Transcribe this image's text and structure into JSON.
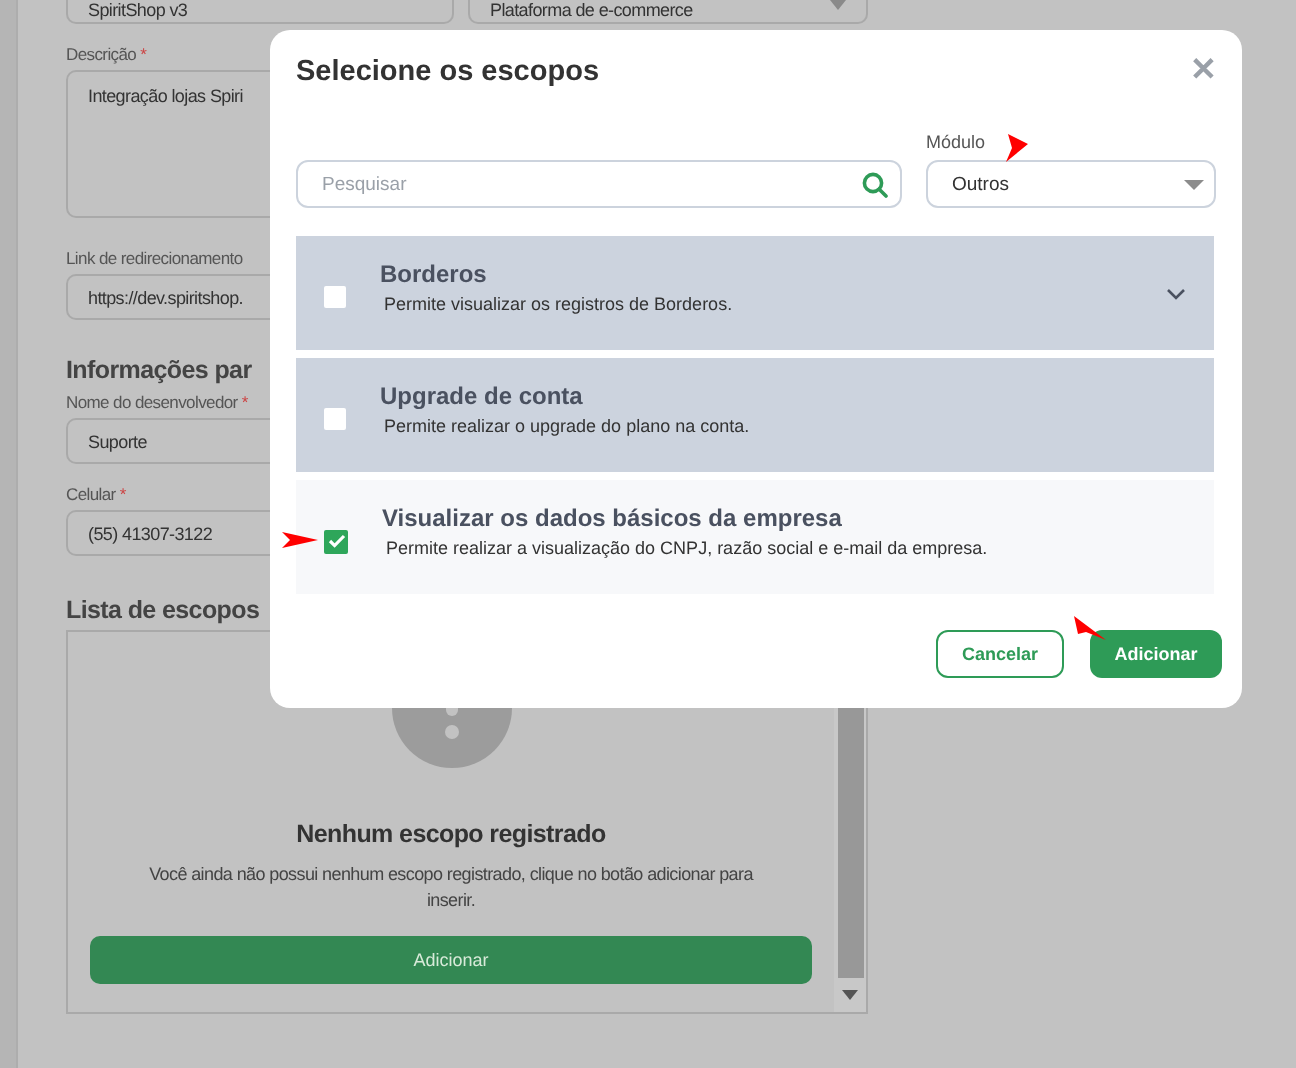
{
  "form": {
    "top_fields": [
      {
        "value": "SpiritShop v3",
        "kind": "text"
      },
      {
        "value": "Plataforma de e-commerce",
        "kind": "select"
      }
    ],
    "description": {
      "label": "Descrição",
      "required_mark": "*",
      "value": "Integração lojas Spiri"
    },
    "redirect": {
      "label": "Link de redirecionamento",
      "value": "https://dev.spiritshop."
    },
    "section_title": "Informações par",
    "developer": {
      "label": "Nome do desenvolvedor",
      "required_mark": "*",
      "value": "Suporte"
    },
    "phone": {
      "label": "Celular",
      "required_mark": "*",
      "value": "(55) 41307-3122"
    },
    "scopes_title": "Lista de escopos",
    "empty_state": {
      "title": "Nenhum escopo registrado",
      "text": "Você ainda não possui nenhum escopo registrado, clique no botão adicionar para inserir.",
      "button": "Adicionar"
    }
  },
  "dialog": {
    "title": "Selecione os escopos",
    "close": "✕",
    "search": {
      "placeholder": "Pesquisar"
    },
    "module": {
      "label": "Módulo",
      "value": "Outros"
    },
    "scopes": [
      {
        "title": "Borderos",
        "description": "Permite visualizar os registros de Borderos.",
        "checked": false,
        "expandable": true
      },
      {
        "title": "Upgrade de conta",
        "description": "Permite realizar o upgrade do plano na conta.",
        "checked": false,
        "expandable": false
      },
      {
        "title": "Visualizar os dados básicos da empresa",
        "description": "Permite realizar a visualização do CNPJ, razão social e e-mail da empresa.",
        "checked": true,
        "expandable": false
      }
    ],
    "buttons": [
      {
        "label": "Cancelar",
        "kind": "secondary"
      },
      {
        "label": "Adicionar",
        "kind": "primary"
      }
    ]
  }
}
